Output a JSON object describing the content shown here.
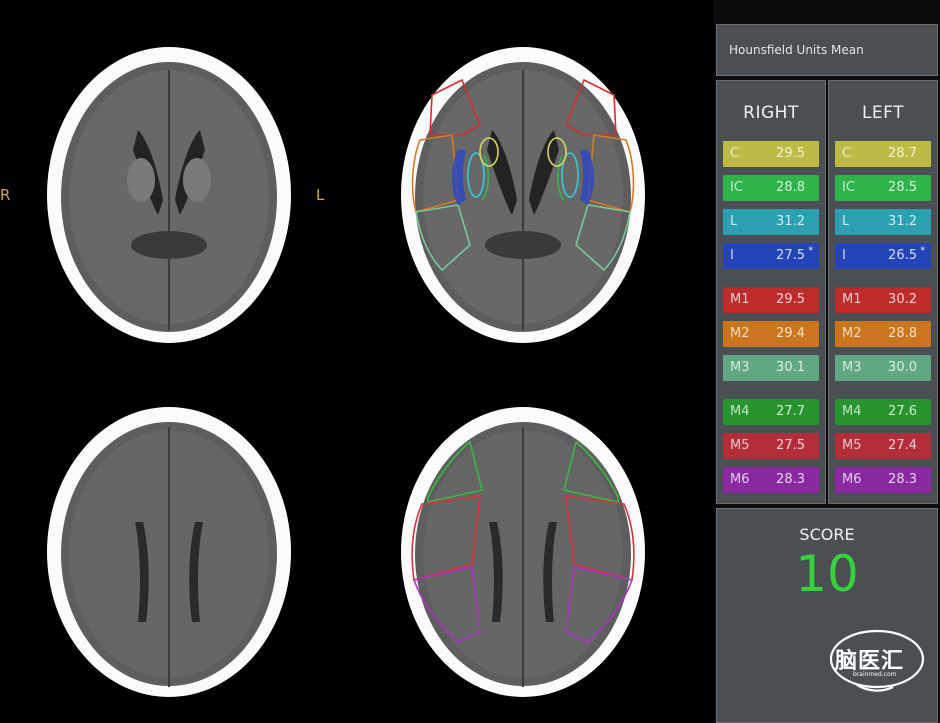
{
  "viewer": {
    "orientation_right": "R",
    "orientation_left": "L"
  },
  "panel": {
    "title": "Hounsfield Units Mean",
    "right_title": "RIGHT",
    "left_title": "LEFT",
    "regions": [
      {
        "label": "C",
        "right": "29.5",
        "left": "28.7",
        "color": "#bcbb45",
        "right_star": "",
        "left_star": ""
      },
      {
        "label": "IC",
        "right": "28.8",
        "left": "28.5",
        "color": "#2fb34a",
        "right_star": "",
        "left_star": ""
      },
      {
        "label": "L",
        "right": "31.2",
        "left": "31.2",
        "color": "#2aa0b0",
        "right_star": "",
        "left_star": ""
      },
      {
        "label": "I",
        "right": "27.5",
        "left": "26.5",
        "color": "#2345b8",
        "right_star": "*",
        "left_star": "*"
      },
      {
        "label": "M1",
        "right": "29.5",
        "left": "30.2",
        "color": "#bd2b2b",
        "right_star": "",
        "left_star": ""
      },
      {
        "label": "M2",
        "right": "29.4",
        "left": "28.8",
        "color": "#c9761f",
        "right_star": "",
        "left_star": ""
      },
      {
        "label": "M3",
        "right": "30.1",
        "left": "30.0",
        "color": "#62a783",
        "right_star": "",
        "left_star": ""
      },
      {
        "label": "M4",
        "right": "27.7",
        "left": "27.6",
        "color": "#27942d",
        "right_star": "",
        "left_star": ""
      },
      {
        "label": "M5",
        "right": "27.5",
        "left": "27.4",
        "color": "#b42d3a",
        "right_star": "",
        "left_star": ""
      },
      {
        "label": "M6",
        "right": "28.3",
        "left": "28.3",
        "color": "#8b2aa0",
        "right_star": "",
        "left_star": ""
      }
    ],
    "score_label": "SCORE",
    "score_value": "10",
    "logo_text": "脑医汇",
    "logo_subtext": "brainmed.com"
  }
}
